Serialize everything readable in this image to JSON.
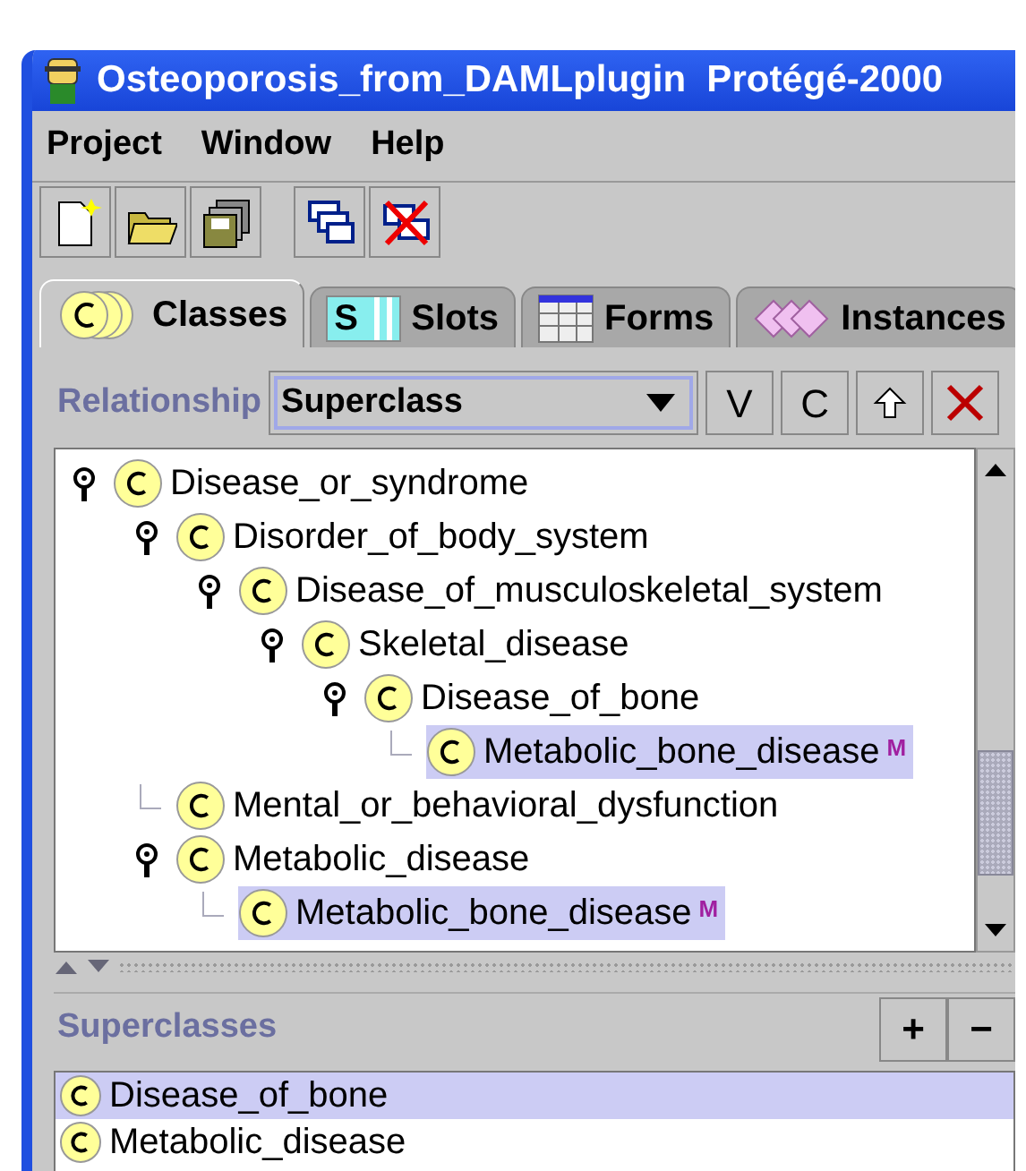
{
  "window": {
    "title": "Osteoporosis_from_DAMLplugin  Protégé-2000"
  },
  "menu": [
    "Project",
    "Window",
    "Help"
  ],
  "tabs": [
    {
      "label": "Classes",
      "kind": "classes",
      "selected": true
    },
    {
      "label": "Slots",
      "kind": "slots",
      "icon_text": "S",
      "selected": false
    },
    {
      "label": "Forms",
      "kind": "forms",
      "selected": false
    },
    {
      "label": "Instances",
      "kind": "instances",
      "selected": false
    }
  ],
  "relationship": {
    "label": "Relationship",
    "value": "Superclass",
    "buttons": [
      "V",
      "C"
    ]
  },
  "tree": [
    {
      "name": "Disease_or_syndrome",
      "expanded": true,
      "selected": false,
      "children": [
        {
          "name": "Disorder_of_body_system",
          "expanded": true,
          "selected": false,
          "children": [
            {
              "name": "Disease_of_musculoskeletal_system",
              "expanded": true,
              "selected": false,
              "children": [
                {
                  "name": "Skeletal_disease",
                  "expanded": true,
                  "selected": false,
                  "children": [
                    {
                      "name": "Disease_of_bone",
                      "expanded": true,
                      "selected": false,
                      "children": [
                        {
                          "name": "Metabolic_bone_disease",
                          "badge": "M",
                          "selected": true
                        }
                      ]
                    }
                  ]
                }
              ]
            }
          ]
        },
        {
          "name": "Mental_or_behavioral_dysfunction",
          "selected": false
        },
        {
          "name": "Metabolic_disease",
          "expanded": true,
          "selected": false,
          "children": [
            {
              "name": "Metabolic_bone_disease",
              "badge": "M",
              "selected": true
            }
          ]
        }
      ]
    }
  ],
  "superclasses": {
    "title": "Superclasses",
    "buttons": [
      "+",
      "−"
    ],
    "items": [
      {
        "name": "Disease_of_bone",
        "selected": true
      },
      {
        "name": "Metabolic_disease",
        "selected": false
      }
    ]
  }
}
